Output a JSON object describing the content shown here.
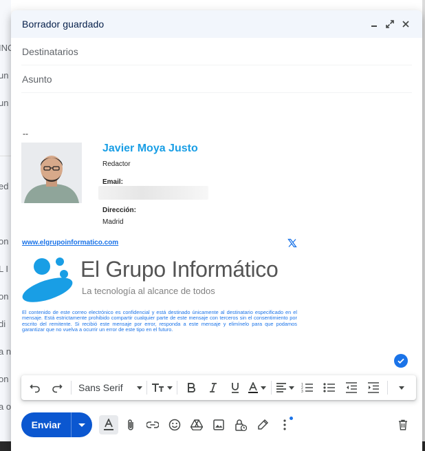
{
  "window": {
    "title": "Borrador guardado",
    "controls": [
      "minimize-icon",
      "expand-icon",
      "close-icon"
    ]
  },
  "fields": {
    "recipients_placeholder": "Destinatarios",
    "subject_placeholder": "Asunto"
  },
  "background_fragments": [
    "INC",
    "un",
    "un",
    "ed",
    "on",
    "L I",
    "on",
    "di",
    "a n",
    "on",
    "a o"
  ],
  "signature": {
    "separator": "--",
    "name": "Javier Moya Justo",
    "role": "Redactor",
    "email_label": "Email:",
    "address_label": "Dirección:",
    "address_value": "Madrid",
    "website": "www.elgrupoinformatico.com",
    "logo_text": "El Grupo Informático",
    "logo_tagline": "La tecnología al alcance de todos",
    "disclaimer": "El contenido de este correo electrónico es confidencial y está destinado únicamente al destinatario especificado en el mensaje. Está estrictamente prohibido compartir cualquier parte de este mensaje con terceros sin el consentimiento por escrito del remitente. Si recibió este mensaje por error, responda a este mensaje y elimínelo para que podamos garantizar que no vuelva a ocurrir un error de este tipo en el futuro.",
    "name_color": "#199ee5",
    "link_color": "#1a73e8"
  },
  "format_toolbar": {
    "font_family": "Sans Serif",
    "icons": [
      "undo-icon",
      "redo-icon",
      "font-size-icon",
      "bold-icon",
      "italic-icon",
      "underline-icon",
      "text-color-icon",
      "align-icon",
      "numbered-list-icon",
      "bulleted-list-icon",
      "indent-less-icon",
      "indent-more-icon",
      "more-formatting-icon"
    ]
  },
  "bottom_bar": {
    "send_label": "Enviar",
    "icons": [
      "formatting-options-icon",
      "attach-icon",
      "link-icon",
      "emoji-icon",
      "drive-icon",
      "photo-icon",
      "confidential-icon",
      "signature-icon",
      "more-options-icon",
      "discard-icon"
    ],
    "accent": "#0b57d0"
  }
}
